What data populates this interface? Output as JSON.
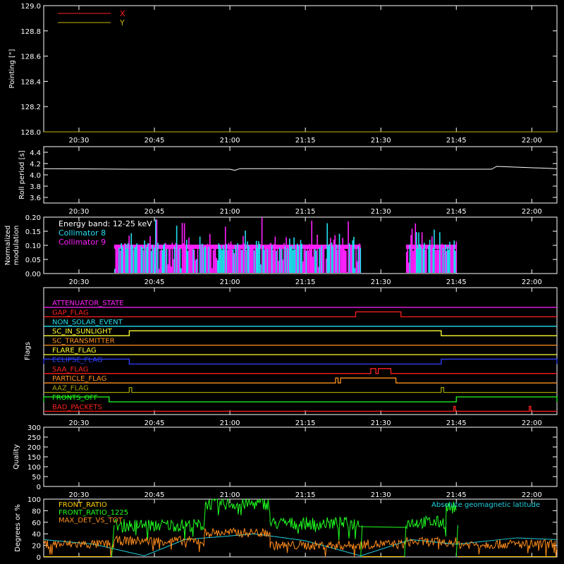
{
  "colors": {
    "background": "#000000",
    "axes": "#ffffff",
    "x": "#ff2020",
    "y": "#c8b400",
    "coll8": "#20e0f0",
    "coll9": "#ff20ff",
    "front_ratio": "#ffd000",
    "front_ratio_1225": "#20ff20",
    "max_det": "#ff8c1a",
    "geomag": "#20d0e0"
  },
  "x_ticks": [
    "20:30",
    "20:45",
    "21:00",
    "21:15",
    "21:30",
    "21:45",
    "22:00"
  ],
  "chart_data": [
    {
      "type": "line",
      "ylabel": "Pointing [\"]",
      "ylim": [
        128.0,
        129.0
      ],
      "yticks": [
        "128.0",
        "128.2",
        "128.4",
        "128.6",
        "128.8",
        "129.0"
      ],
      "legend": [
        "X",
        "Y"
      ],
      "legend_position": "top-left",
      "series": [
        {
          "name": "X",
          "x": [
            "20:23",
            "22:05"
          ],
          "y": [
            128.0,
            128.0
          ]
        },
        {
          "name": "Y",
          "x": [
            "20:23",
            "22:05"
          ],
          "y": [
            128.0,
            128.0
          ]
        }
      ]
    },
    {
      "type": "line",
      "ylabel": "Roll period [s]",
      "ylim": [
        3.5,
        4.5
      ],
      "yticks": [
        "3.6",
        "3.8",
        "4.0",
        "4.2",
        "4.4"
      ],
      "series": [
        {
          "x": [
            "20:23",
            "20:40",
            "21:00",
            "21:01",
            "21:02",
            "21:45",
            "21:52",
            "21:53",
            "22:05"
          ],
          "y": [
            4.11,
            4.1,
            4.1,
            4.08,
            4.11,
            4.1,
            4.1,
            4.15,
            4.11
          ]
        }
      ]
    },
    {
      "type": "bar",
      "ylabel_lines": [
        "Normalized",
        "modulation"
      ],
      "ylim": [
        0.0,
        0.2
      ],
      "yticks": [
        "0.00",
        "0.05",
        "0.10",
        "0.15",
        "0.20"
      ],
      "annotation": "Energy band: 12-25 keV",
      "legend": [
        "Collimator 8",
        "Collimator 9"
      ],
      "legend_position": "top-left",
      "active_intervals": [
        [
          "20:37",
          "21:26"
        ],
        [
          "21:35",
          "21:45"
        ]
      ],
      "typical_value": 0.095,
      "max_value": 0.2
    },
    {
      "type": "step",
      "ylabel": "Flags",
      "flags": [
        {
          "label": "ATTENUATOR_STATE",
          "color": "#ff20ff",
          "on": []
        },
        {
          "label": "GAP_FLAG",
          "color": "#ff2020",
          "on": [
            [
              "21:25",
              "21:34"
            ]
          ]
        },
        {
          "label": "NON_SOLAR_EVENT",
          "color": "#20e0f0",
          "on": []
        },
        {
          "label": "SC_IN_SUNLIGHT",
          "color": "#ffff30",
          "on": [
            [
              "20:40",
              "21:42"
            ]
          ]
        },
        {
          "label": "SC_TRANSMITTER",
          "color": "#ff9020",
          "on": []
        },
        {
          "label": "FLARE_FLAG",
          "color": "#ffff30",
          "on": []
        },
        {
          "label": "ECLIPSE_FLAG",
          "color": "#3040ff",
          "on": [
            [
              "20:23",
              "20:40"
            ],
            [
              "21:42",
              "22:05"
            ]
          ]
        },
        {
          "label": "SAA_FLAG",
          "color": "#ff2020",
          "on": [
            [
              "21:28",
              "21:29"
            ],
            [
              "21:29.5",
              "21:32"
            ]
          ]
        },
        {
          "label": "PARTICLE_FLAG",
          "color": "#ff9020",
          "on": [
            [
              "21:21",
              "21:21.5"
            ],
            [
              "21:22",
              "21:33"
            ]
          ]
        },
        {
          "label": "AAZ_FLAG",
          "color": "#a0a000",
          "on": [
            [
              "20:40",
              "20:40.5"
            ],
            [
              "21:42",
              "21:42.5"
            ]
          ]
        },
        {
          "label": "FRONTS_OFF",
          "color": "#20ff20",
          "on": [
            [
              "20:23",
              "20:36"
            ],
            [
              "21:45",
              "22:05"
            ]
          ]
        },
        {
          "label": "BAD_PACKETS",
          "color": "#ff2020",
          "on": [
            [
              "21:44.5",
              "21:44.8"
            ],
            [
              "21:59.5",
              "21:59.8"
            ]
          ]
        }
      ]
    },
    {
      "type": "line",
      "ylabel": "Quality",
      "ylim": [
        0,
        300
      ],
      "yticks": [
        "0",
        "50",
        "100",
        "150",
        "200",
        "250",
        "300"
      ],
      "series": []
    },
    {
      "type": "line",
      "ylabel": "Degrees or %",
      "ylim": [
        0,
        100
      ],
      "yticks": [
        "0",
        "20",
        "40",
        "60",
        "80",
        "100"
      ],
      "legend": [
        "FRONT_RATIO",
        "FRONT_RATIO_1225",
        "MAX_DET_VS_TOT"
      ],
      "legend_position": "top-left",
      "annotation": "Absolute geomagnetic latitude",
      "series": [
        {
          "name": "FRONT_RATIO",
          "levels": [
            [
              "20:37",
              "20:55",
              55
            ],
            [
              "20:55",
              "21:08",
              92
            ],
            [
              "21:08",
              "21:26",
              58
            ],
            [
              "21:35",
              "21:43",
              60
            ],
            [
              "21:43",
              "21:45",
              85
            ]
          ]
        },
        {
          "name": "FRONT_RATIO_1225",
          "levels": [
            [
              "20:37",
              "20:55",
              55
            ],
            [
              "20:55",
              "21:08",
              92
            ],
            [
              "21:08",
              "21:26",
              58
            ],
            [
              "21:35",
              "21:43",
              60
            ],
            [
              "21:43",
              "21:45",
              85
            ]
          ]
        },
        {
          "name": "MAX_DET_VS_TOT",
          "levels": [
            [
              "20:23",
              "20:37",
              22
            ],
            [
              "20:37",
              "20:55",
              28
            ],
            [
              "20:55",
              "21:08",
              42
            ],
            [
              "21:08",
              "21:26",
              20
            ],
            [
              "21:26",
              "21:35",
              22
            ],
            [
              "21:35",
              "21:45",
              26
            ],
            [
              "21:45",
              "22:05",
              22
            ]
          ]
        },
        {
          "name": "Absolute geomagnetic latitude",
          "x": [
            "20:23",
            "20:33",
            "20:43",
            "20:51",
            "21:05",
            "21:15",
            "21:26",
            "21:36",
            "21:45",
            "21:57",
            "22:05"
          ],
          "y": [
            30,
            22,
            2,
            30,
            40,
            28,
            2,
            30,
            22,
            33,
            30
          ]
        }
      ]
    }
  ]
}
